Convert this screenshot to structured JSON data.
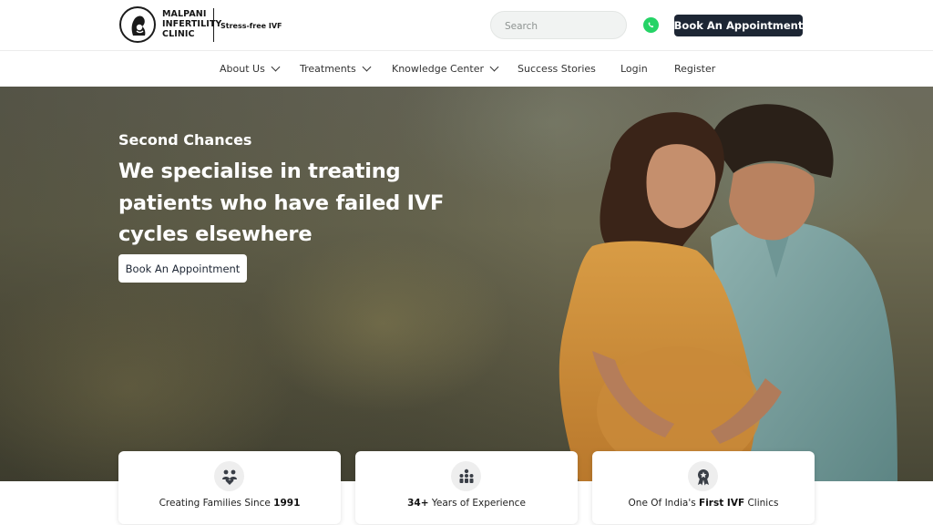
{
  "header": {
    "logo_lines": [
      "MALPANI",
      "INFERTILITY",
      "CLINIC"
    ],
    "tagline": "Stress-free IVF",
    "search_placeholder": "Search",
    "book_button": "Book An Appointment",
    "whatsapp_icon": "whatsapp-icon"
  },
  "nav": {
    "items": [
      {
        "label": "About Us",
        "dropdown": true
      },
      {
        "label": "Treatments",
        "dropdown": true
      },
      {
        "label": "Knowledge Center",
        "dropdown": true
      },
      {
        "label": "Success Stories",
        "dropdown": false
      },
      {
        "label": "Login",
        "dropdown": false
      },
      {
        "label": "Register",
        "dropdown": false
      }
    ]
  },
  "hero": {
    "eyebrow": "Second Chances",
    "headline_lines": [
      "We specialise in treating",
      "patients who have failed IVF",
      "cycles elsewhere"
    ],
    "cta": "Book An Appointment"
  },
  "stats": [
    {
      "icon": "family-icon",
      "text_before": "Creating Families Since ",
      "bold": "1991",
      "text_after": ""
    },
    {
      "icon": "team-icon",
      "text_before": "",
      "bold": "34+",
      "text_after": " Years of Experience"
    },
    {
      "icon": "award-icon",
      "text_before": "One Of India's ",
      "bold": "First IVF",
      "text_after": " Clinics"
    }
  ],
  "colors": {
    "primary_dark": "#1d2634",
    "whatsapp": "#25d366",
    "search_bg": "#f1f3f2"
  }
}
